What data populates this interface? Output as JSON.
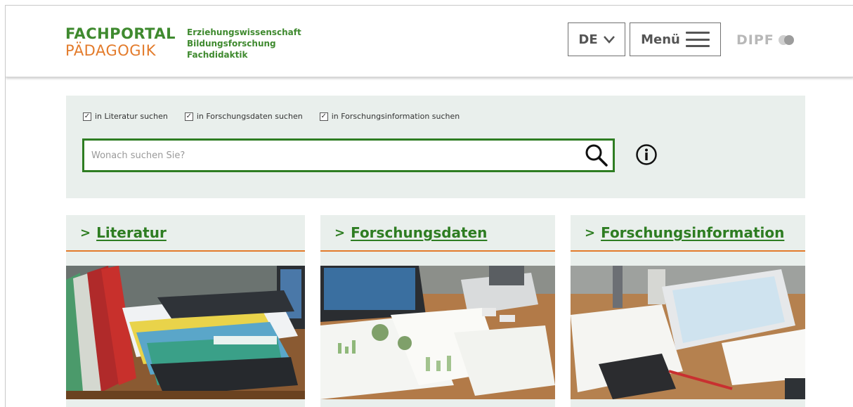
{
  "header": {
    "logo_line1": "FACHPORTAL",
    "logo_line2": "PÄDAGOGIK",
    "logo_sub": [
      "Erziehungswissenschaft",
      "Bildungsforschung",
      "Fachdidaktik"
    ],
    "language_label": "DE",
    "menu_label": "Menü",
    "partner_logo": "DIPF"
  },
  "search": {
    "scopes": [
      {
        "label": "in Literatur suchen",
        "checked": true
      },
      {
        "label": "in Forschungsdaten suchen",
        "checked": true
      },
      {
        "label": "in Forschungsinformation suchen",
        "checked": true
      }
    ],
    "placeholder": "Wonach suchen Sie?",
    "value": ""
  },
  "cards": [
    {
      "title": "Literatur",
      "icon": "book-stack-photo"
    },
    {
      "title": "Forschungsdaten",
      "icon": "laptop-charts-photo"
    },
    {
      "title": "Forschungsinformation",
      "icon": "tablet-documents-photo"
    }
  ],
  "colors": {
    "brand_green": "#2e7d22",
    "logo_green": "#3f8a2f",
    "brand_orange": "#e37b2b",
    "panel_bg": "#e9efec"
  },
  "icons": {
    "search": "magnifier-icon",
    "info": "info-circle-icon",
    "language": "chevron-down-icon",
    "menu": "hamburger-icon"
  }
}
